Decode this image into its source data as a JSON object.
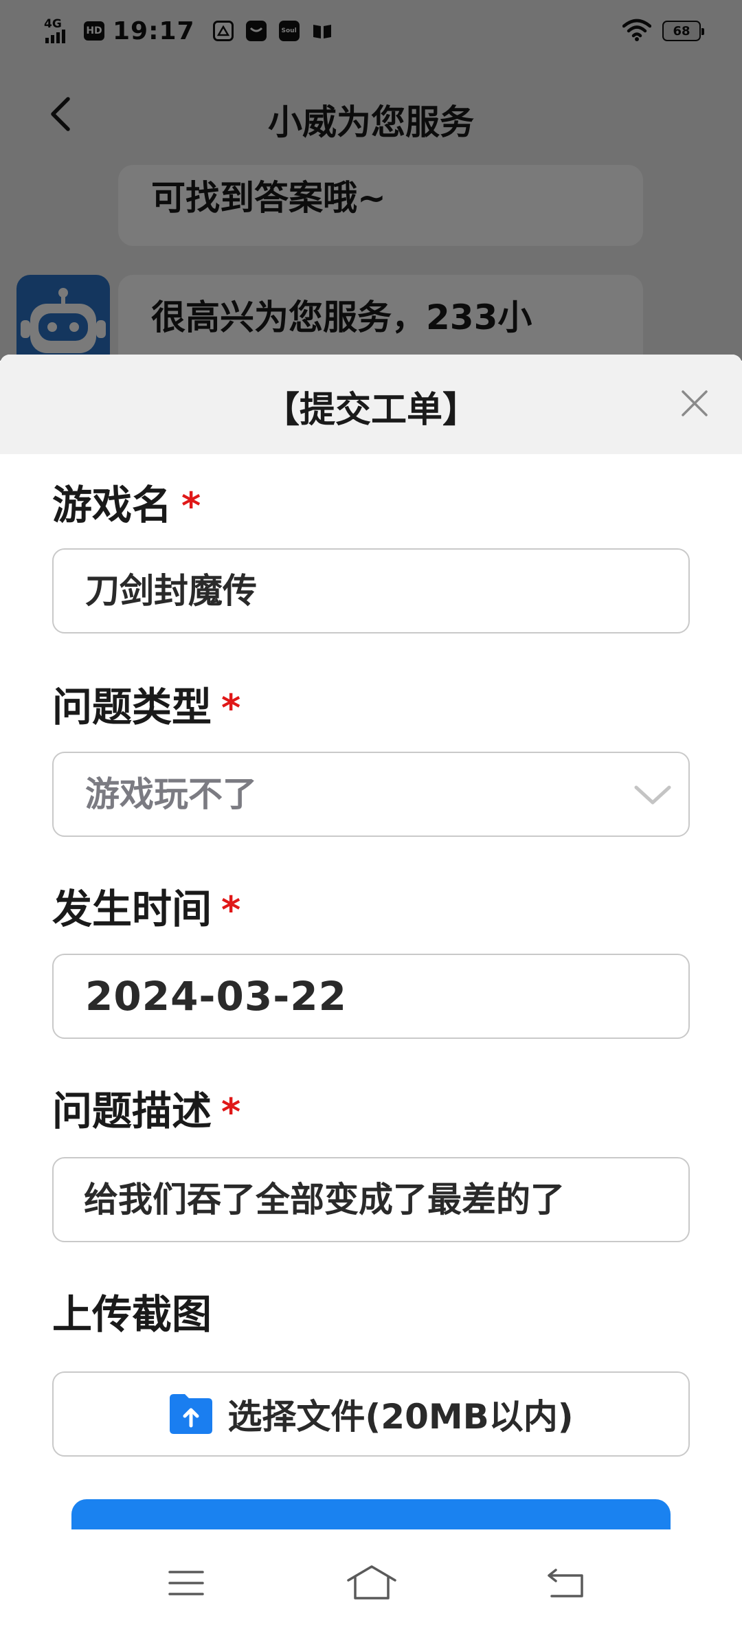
{
  "status_bar": {
    "network": "4G",
    "hd": "HD",
    "time": "19:17",
    "app_badge_soul": "Soul",
    "battery": "68"
  },
  "header": {
    "title": "小威为您服务"
  },
  "chat": {
    "bubble1_text": "可找到答案哦~",
    "bubble2_text": "很高兴为您服务，233小"
  },
  "sheet": {
    "title": "【提交工单】",
    "fields": {
      "game_name": {
        "label": "游戏名",
        "required_mark": "*",
        "value": "刀剑封魔传"
      },
      "issue_type": {
        "label": "问题类型",
        "required_mark": "*",
        "value": "游戏玩不了"
      },
      "occur_time": {
        "label": "发生时间",
        "required_mark": "*",
        "value": "2024-03-22"
      },
      "description": {
        "label": "问题描述",
        "required_mark": "*",
        "value": "给我们吞了全部变成了最差的了"
      },
      "screenshot": {
        "label": "上传截图",
        "button": "选择文件(20MB以内)"
      }
    }
  },
  "colors": {
    "accent": "#1a82f0",
    "required": "#e01818",
    "bot_avatar": "#2a72c4"
  },
  "icons": [
    "back-arrow-icon",
    "close-icon",
    "chevron-down-icon",
    "upload-folder-icon",
    "menu-icon",
    "home-icon",
    "back-icon"
  ]
}
